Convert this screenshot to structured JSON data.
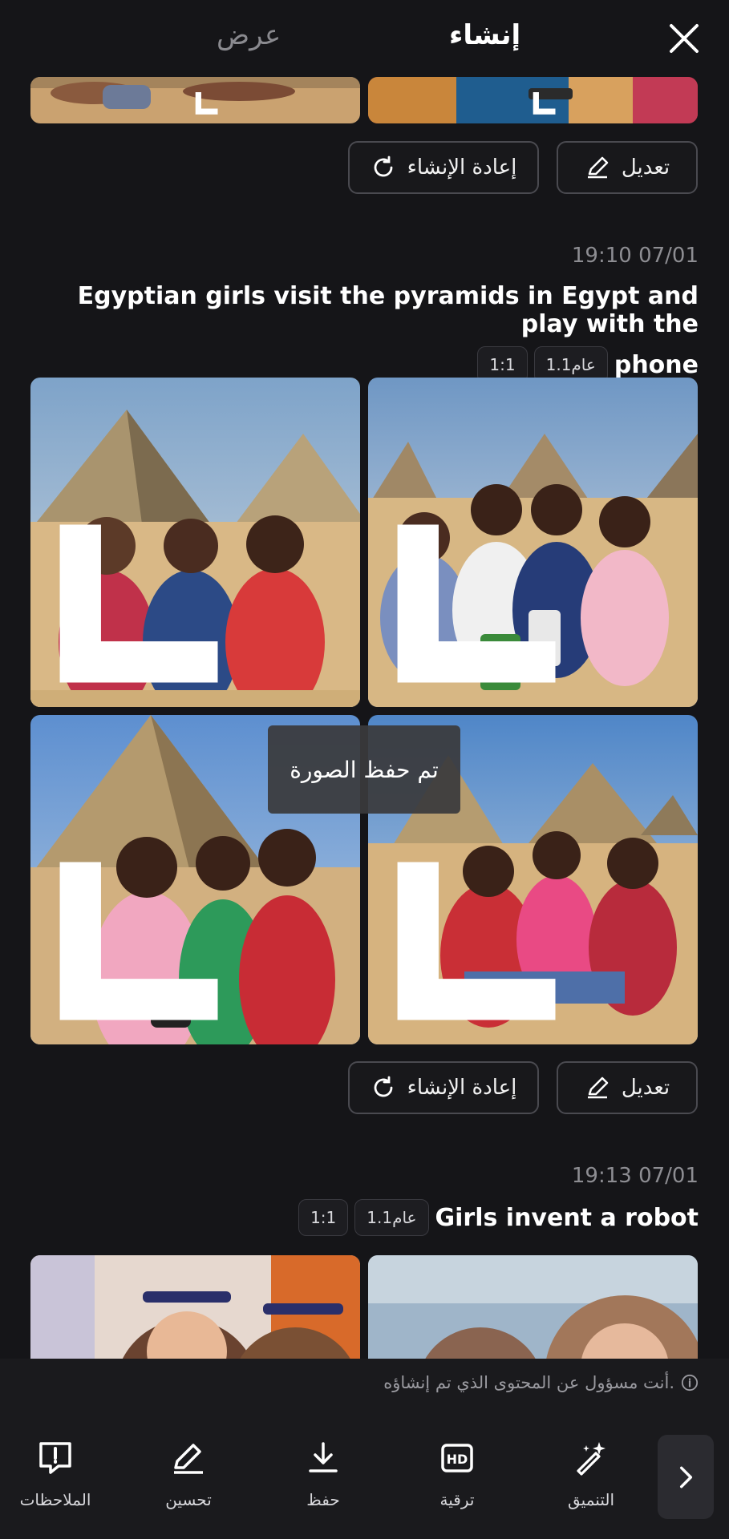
{
  "header": {
    "tab_view": "عرض",
    "tab_create": "إنشاء",
    "close_icon": "close-icon"
  },
  "actions": {
    "edit_label": "تعديل",
    "regenerate_label": "إعادة الإنشاء"
  },
  "generations": [
    {
      "timestamp": "19:10 07/01",
      "prompt_line1": "Egyptian girls visit the pyramids in Egypt and play with the",
      "prompt_line2": "phone",
      "model_chip": "عام1.1",
      "ratio_chip": "1:1"
    },
    {
      "timestamp": "19:13 07/01",
      "prompt_line1": "Girls invent a robot",
      "model_chip": "عام1.1",
      "ratio_chip": "1:1"
    }
  ],
  "toast": "تم حفظ الصورة",
  "disclaimer": "أنت مسؤول عن المحتوى الذي تم إنشاؤه.",
  "toolbar": {
    "feedback": "الملاحظات",
    "improve": "تحسين",
    "save": "حفظ",
    "upscale": "ترقية",
    "enhance": "التنميق"
  },
  "colors": {
    "background": "#151518",
    "panel": "#1a1a1d",
    "text": "#ffffff",
    "muted": "#8d8d92"
  }
}
